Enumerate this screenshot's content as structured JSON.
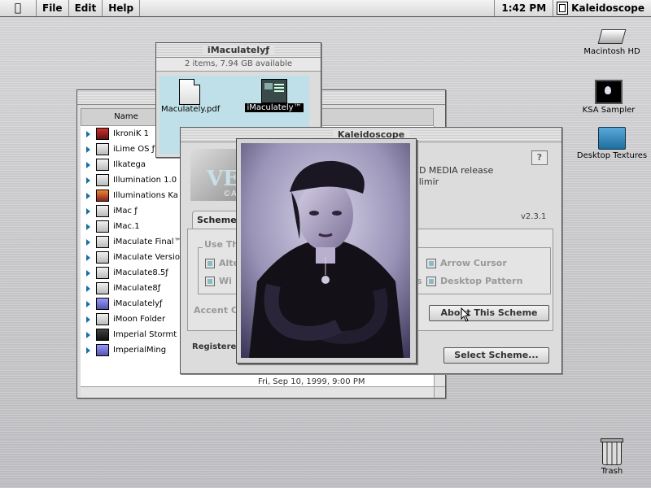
{
  "menubar": {
    "apple": "",
    "items": [
      "File",
      "Edit",
      "Help"
    ],
    "clock": "1:42 PM",
    "app_name": "Kaleidoscope"
  },
  "desktop": {
    "icons": [
      {
        "label": "Macintosh HD",
        "icon": "hard-drive-icon"
      },
      {
        "label": "KSA Sampler",
        "icon": "ksa-app-icon"
      },
      {
        "label": "Desktop Textures",
        "icon": "folder-icon"
      },
      {
        "label": "Trash",
        "icon": "trash-icon"
      }
    ]
  },
  "folder_window": {
    "title": "iMaculatelyƒ",
    "info": "2 items, 7.94 GB available",
    "files": [
      {
        "label": "Maculately.pdf",
        "icon": "document-icon"
      },
      {
        "label": "iMaculately™",
        "icon": "app-icon"
      }
    ]
  },
  "list_window": {
    "column_name": "Name",
    "date_fragment": "Fri, Sep 10, 1999, 9:00 PM",
    "rows": [
      {
        "name": "IkroniK 1",
        "icon": "red"
      },
      {
        "name": "iLime OS ƒ",
        "icon": "folder"
      },
      {
        "name": "Ilkatega",
        "icon": "folder"
      },
      {
        "name": "Illumination 1.0",
        "icon": "folder"
      },
      {
        "name": "Illuminations Ka",
        "icon": "orange"
      },
      {
        "name": "iMac ƒ",
        "icon": "folder"
      },
      {
        "name": "iMac.1",
        "icon": "folder"
      },
      {
        "name": "iMaculate Final™",
        "icon": "folder"
      },
      {
        "name": "iMaculate Versio",
        "icon": "folder"
      },
      {
        "name": "iMaculate8.5ƒ",
        "icon": "folder"
      },
      {
        "name": "iMaculate8ƒ",
        "icon": "folder"
      },
      {
        "name": "iMaculatelyƒ",
        "icon": "purple"
      },
      {
        "name": "iMoon Folder",
        "icon": "folder"
      },
      {
        "name": "Imperial Stormt",
        "icon": "dark"
      },
      {
        "name": "ImperialMing",
        "icon": "purple"
      }
    ]
  },
  "kaleidoscope": {
    "title": "Kaleidoscope",
    "banner_text": "VE",
    "banner_sub": "©A",
    "release_text": "ED MEDIA release",
    "author_text": "alimir",
    "help": "?",
    "version": "v2.3.1",
    "tab_active": "Scheme",
    "use_this": "Use This",
    "checkboxes": [
      {
        "label": "Alte",
        "key": "left1"
      },
      {
        "label": "Wi",
        "key": "left2"
      },
      {
        "label": "Arrow Cursor",
        "key": "right1"
      },
      {
        "label": "Desktop Pattern",
        "key": "right2"
      },
      {
        "label": "s",
        "key": "mid2"
      }
    ],
    "accent_label": "Accent C",
    "about_button": "About This Scheme",
    "select_button": "Select Scheme...",
    "registered": "Registere"
  },
  "photo": {
    "icon": "portrait-photo"
  }
}
